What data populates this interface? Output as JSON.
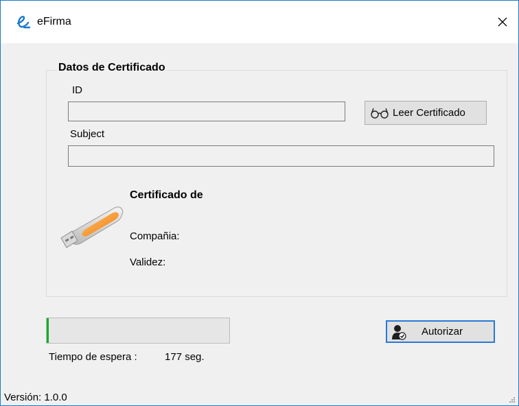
{
  "window": {
    "title": "eFirma",
    "app_icon": "efirma-logo-icon",
    "close_icon": "close-icon",
    "accent_color": "#1979ca"
  },
  "group": {
    "title": "Datos de Certificado",
    "id_label": "ID",
    "id_value": "",
    "subject_label": "Subject",
    "subject_value": "",
    "read_button": {
      "label": "Leer Certificado",
      "icon": "glasses-icon"
    }
  },
  "certificate": {
    "heading": "Certificado de",
    "icon": "usb-drive-icon",
    "company_label": "Compañia:",
    "validity_label": "Validez:"
  },
  "progress": {
    "value_percent": 1,
    "color": "#06b025"
  },
  "wait": {
    "label": "Tiempo de espera :",
    "value": "177 seg."
  },
  "authorize_button": {
    "label": "Autorizar",
    "icon": "user-authorize-icon"
  },
  "status": {
    "version": "Versión: 1.0.0"
  }
}
